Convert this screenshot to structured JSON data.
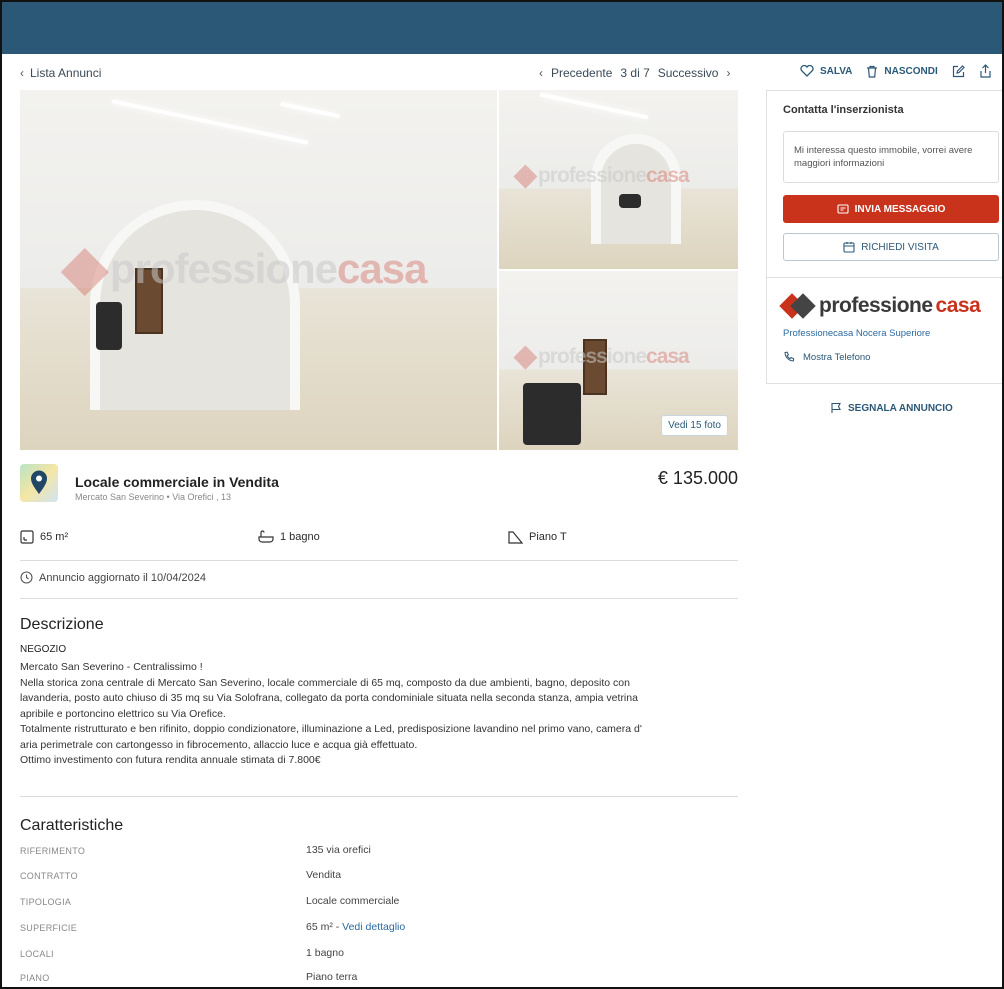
{
  "subnav": {
    "back_label": "Lista Annunci",
    "prev_label": "Precedente",
    "position": "3 di 7",
    "next_label": "Successivo"
  },
  "actions": {
    "save_label": "SALVA",
    "hide_label": "NASCONDI"
  },
  "gallery": {
    "watermark_brand_a": "professione",
    "watermark_brand_b": "casa",
    "more_photos_label": "Vedi 15 foto"
  },
  "listing": {
    "title": "Locale commerciale in Vendita",
    "address_area": "Mercato San Severino",
    "address_street": "Via Orefici , 13",
    "price": "€ 135.000"
  },
  "features": {
    "surface": "65 m²",
    "bathrooms": "1 bagno",
    "floor": "Piano T"
  },
  "updated": "Annuncio aggiornato il 10/04/2024",
  "description": {
    "title": "Descrizione",
    "subtitle": "NEGOZIO",
    "lines": [
      "Mercato San Severino - Centralissimo !",
      "Nella storica zona centrale di Mercato San Severino, locale commerciale di 65 mq, composto da due ambienti, bagno, deposito con",
      "lavanderia, posto auto chiuso di 35 mq su Via Solofrana, collegato da porta condominiale situata nella seconda stanza, ampia vetrina",
      "apribile e portoncino elettrico su Via Orefice.",
      "Totalmente ristrutturato e ben rifinito, doppio condizionatore, illuminazione a Led, predisposizione lavandino nel primo vano, camera d'",
      "aria perimetrale con cartongesso in fibrocemento, allaccio luce e acqua già effettuato.",
      "Ottimo investimento con futura rendita annuale stimata di 7.800€"
    ]
  },
  "characteristics": {
    "title": "Caratteristiche",
    "rows": [
      {
        "key": "RIFERIMENTO",
        "value": "135 via orefici"
      },
      {
        "key": "CONTRATTO",
        "value": "Vendita"
      },
      {
        "key": "TIPOLOGIA",
        "value": "Locale commerciale"
      },
      {
        "key": "SUPERFICIE",
        "value": "65 m² - ",
        "link": "Vedi dettaglio"
      },
      {
        "key": "LOCALI",
        "value": "1 bagno"
      },
      {
        "key": "PIANO",
        "value": "Piano terra"
      }
    ]
  },
  "contact": {
    "heading": "Contatta l'inserzionista",
    "message": "Mi interessa questo immobile, vorrei avere maggiori informazioni",
    "send_label": "INVIA MESSAGGIO",
    "visit_label": "RICHIEDI VISITA",
    "logo_a": "professione",
    "logo_b": "casa",
    "agency": "Professionecasa Nocera Superiore",
    "phone_label": "Mostra Telefono",
    "report_label": "SEGNALA ANNUNCIO"
  },
  "colors": {
    "header": "#2c5877",
    "accent_red": "#c9321b",
    "link_blue": "#2c6aa0"
  }
}
